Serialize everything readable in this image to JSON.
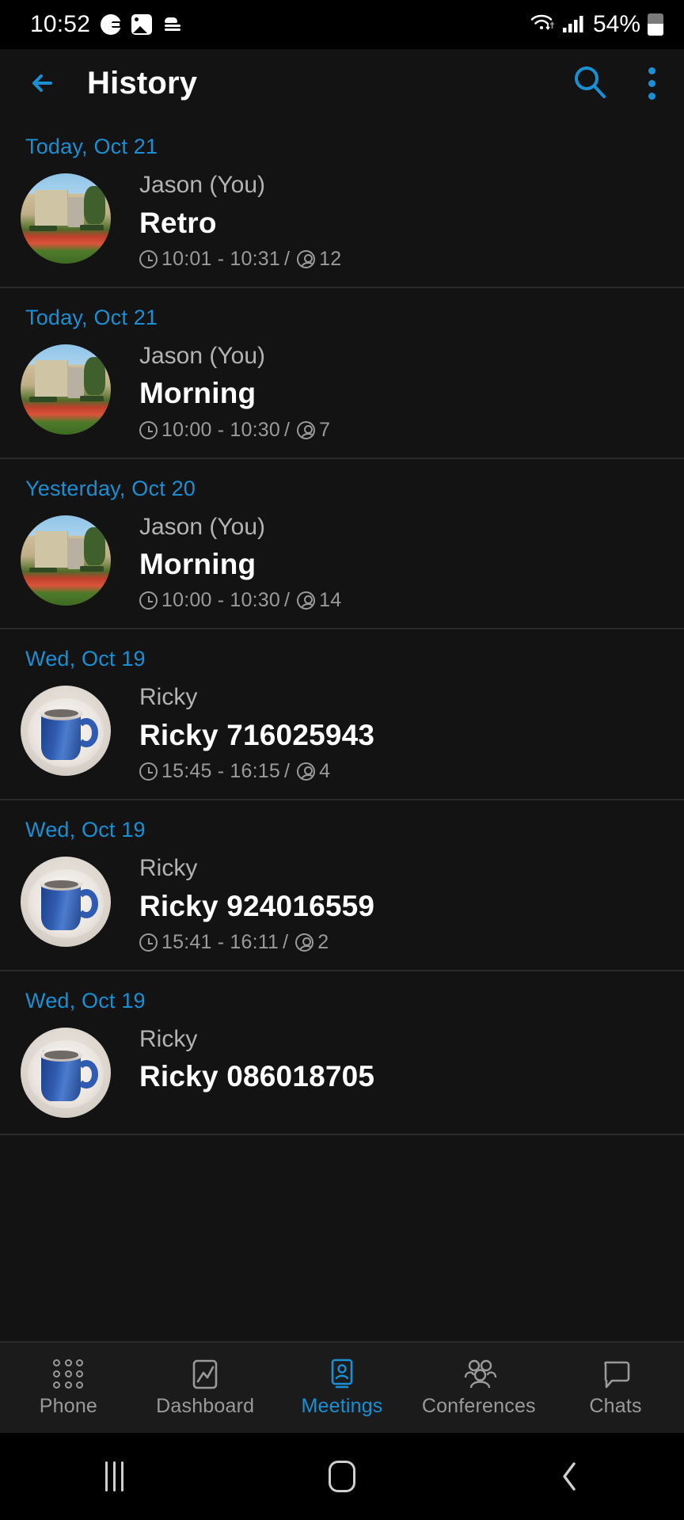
{
  "status_bar": {
    "time": "10:52",
    "battery_percent": "54%",
    "icons": [
      "grammarly-icon",
      "image-icon",
      "layers-icon",
      "wifi-icon",
      "cellular-signal-icon",
      "battery-icon"
    ]
  },
  "app_bar": {
    "title": "History",
    "back_icon": "back-arrow-icon",
    "search_icon": "search-icon",
    "overflow_icon": "kebab-menu-icon",
    "accent_color": "#1a8fd4"
  },
  "history": {
    "items": [
      {
        "date": "Today, Oct 21",
        "owner": "Jason (You)",
        "title": "Retro",
        "time_range": "10:01 - 10:31",
        "separator": "/",
        "participants": "12",
        "avatar": "park-photo"
      },
      {
        "date": "Today, Oct 21",
        "owner": "Jason (You)",
        "title": "Morning",
        "time_range": "10:00 - 10:30",
        "separator": "/",
        "participants": "7",
        "avatar": "park-photo"
      },
      {
        "date": "Yesterday, Oct 20",
        "owner": "Jason (You)",
        "title": "Morning",
        "time_range": "10:00 - 10:30",
        "separator": "/",
        "participants": "14",
        "avatar": "park-photo"
      },
      {
        "date": "Wed, Oct 19",
        "owner": "Ricky",
        "title": "Ricky 716025943",
        "time_range": "15:45 - 16:15",
        "separator": "/",
        "participants": "4",
        "avatar": "coffee-mug-photo"
      },
      {
        "date": "Wed, Oct 19",
        "owner": "Ricky",
        "title": "Ricky 924016559",
        "time_range": "15:41 - 16:11",
        "separator": "/",
        "participants": "2",
        "avatar": "coffee-mug-photo"
      },
      {
        "date": "Wed, Oct 19",
        "owner": "Ricky",
        "title": "Ricky 086018705",
        "time_range": "",
        "separator": "",
        "participants": "",
        "avatar": "coffee-mug-photo"
      }
    ]
  },
  "bottom_nav": {
    "active": "Meetings",
    "items": [
      {
        "label": "Phone",
        "icon": "dialpad-icon"
      },
      {
        "label": "Dashboard",
        "icon": "chart-icon"
      },
      {
        "label": "Meetings",
        "icon": "meeting-person-screen-icon"
      },
      {
        "label": "Conferences",
        "icon": "group-people-icon"
      },
      {
        "label": "Chats",
        "icon": "speech-bubble-icon"
      }
    ]
  },
  "system_nav": {
    "recents": "recents-icon",
    "home": "home-icon",
    "back": "back-icon"
  }
}
